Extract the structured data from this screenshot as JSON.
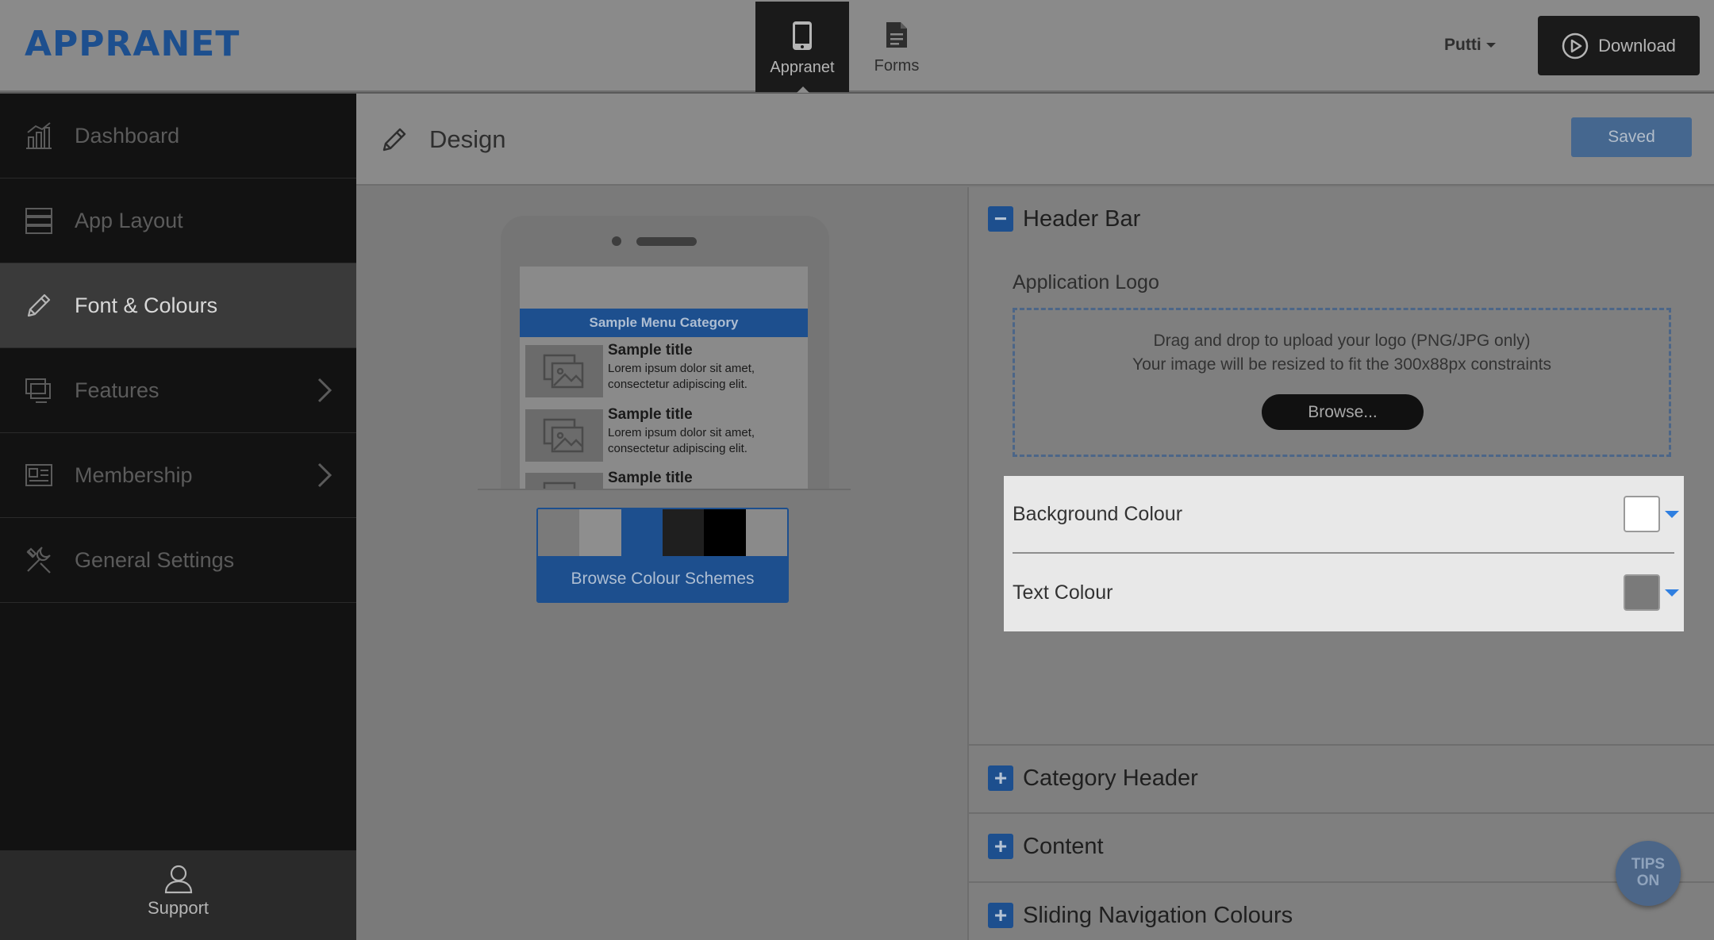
{
  "brand": {
    "logo_text": "APPRANET"
  },
  "topnav": {
    "tabs": [
      {
        "label": "Appranet",
        "icon": "phone-icon",
        "active": true
      },
      {
        "label": "Forms",
        "icon": "document-icon",
        "active": false
      }
    ],
    "user_name": "Putti",
    "download_label": "Download"
  },
  "sidebar": {
    "items": [
      {
        "label": "Dashboard",
        "icon": "chart-icon"
      },
      {
        "label": "App Layout",
        "icon": "layout-icon"
      },
      {
        "label": "Font & Colours",
        "icon": "pencil-icon",
        "active": true
      },
      {
        "label": "Features",
        "icon": "screens-icon",
        "has_submenu": true
      },
      {
        "label": "Membership",
        "icon": "id-card-icon",
        "has_submenu": true
      },
      {
        "label": "General Settings",
        "icon": "tools-icon"
      }
    ],
    "support_label": "Support"
  },
  "page": {
    "title": "Design",
    "saved_label": "Saved"
  },
  "preview": {
    "menu_category": "Sample Menu Category",
    "cards": [
      {
        "title": "Sample title",
        "text": "Lorem ipsum dolor sit amet, consectetur adipiscing elit."
      },
      {
        "title": "Sample title",
        "text": "Lorem ipsum dolor sit amet, consectetur adipiscing elit."
      },
      {
        "title": "Sample title",
        "text": ""
      }
    ],
    "scheme_colors": [
      "#7a7a7a",
      "#8e8e8e",
      "#1d4f8e",
      "#1f1f1f",
      "#000000",
      "#8a8a8a"
    ],
    "browse_schemes_label": "Browse Colour Schemes"
  },
  "panel": {
    "sections": [
      {
        "label": "Header Bar",
        "expanded": true
      },
      {
        "label": "Category Header",
        "expanded": false
      },
      {
        "label": "Content",
        "expanded": false
      },
      {
        "label": "Sliding Navigation Colours",
        "expanded": false
      }
    ],
    "header_bar": {
      "logo_label": "Application Logo",
      "drop_line1": "Drag and drop to upload your logo (PNG/JPG only)",
      "drop_line2": "Your image will be resized to fit the 300x88px constraints",
      "browse_label": "Browse...",
      "colours": [
        {
          "label": "Background Colour",
          "value": "#ffffff"
        },
        {
          "label": "Text Colour",
          "value": "#7a7a7a"
        }
      ]
    }
  },
  "tips": {
    "line1": "TIPS",
    "line2": "ON"
  },
  "accent_color": "#1d4f8e"
}
